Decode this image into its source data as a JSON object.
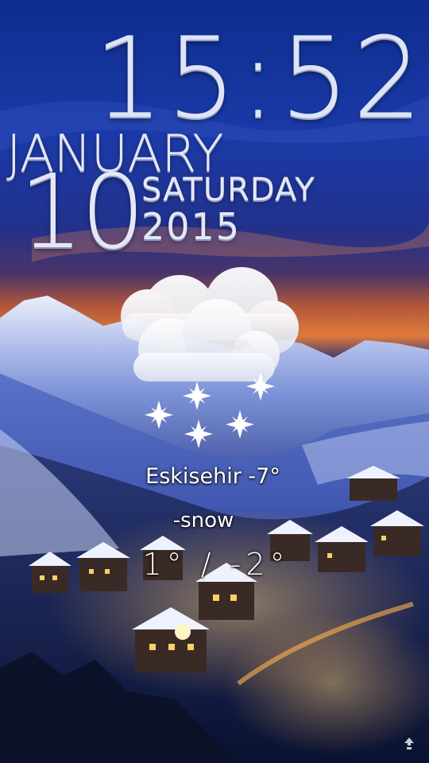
{
  "clock": {
    "time": "15:52"
  },
  "date": {
    "month": "JANUARY",
    "day": "10",
    "weekday": "SATURDAY",
    "year": "2015"
  },
  "weather": {
    "icon": "cloud-snow-icon",
    "location_temp": "Eskisehir -7°",
    "condition": "-snow",
    "range": "1° / -2°"
  },
  "corner": {
    "icon": "unlock-arrow-icon"
  }
}
